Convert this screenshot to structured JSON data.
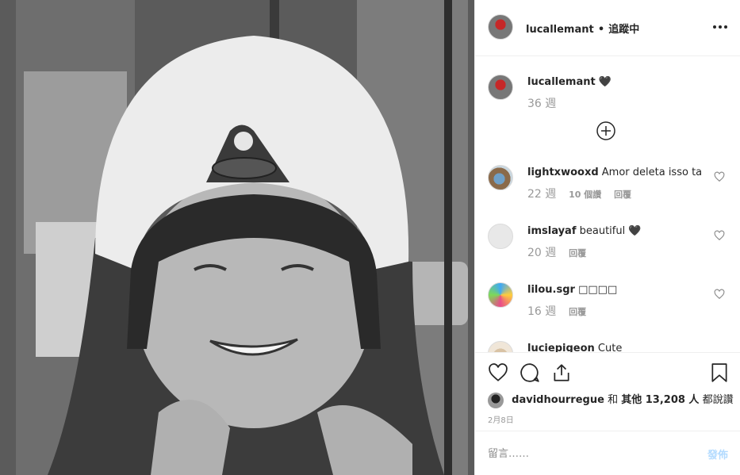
{
  "header": {
    "username": "lucallemant",
    "separator": "•",
    "follow_label": "追蹤中",
    "more_icon": "more-icon"
  },
  "caption": {
    "username": "lucallemant",
    "text": "🖤",
    "time": "36 週"
  },
  "load_more_icon": "plus-circle-icon",
  "comments": [
    {
      "username": "lightxwooxd",
      "text": "Amor deleta isso ta",
      "time": "22 週",
      "replies": "10 個讚",
      "reply": "回覆"
    },
    {
      "username": "imslayaf",
      "text": "beautiful 🖤",
      "time": "20 週",
      "reply": "回覆"
    },
    {
      "username": "lilou.sgr",
      "text": "□□□□",
      "time": "16 週",
      "reply": "回覆"
    },
    {
      "username": "luciepigeon",
      "text": "Cute"
    }
  ],
  "likes": {
    "first_user": "davidhourregue",
    "and": "和",
    "others": "其他 13,208 人",
    "suffix": "都說讚"
  },
  "date": "2月8日",
  "add_comment": {
    "placeholder": "留言……",
    "post_label": "發佈"
  },
  "colors": {
    "post_button_disabled": "#b3dbff",
    "secondary_text": "#999999",
    "border": "#efefef"
  }
}
